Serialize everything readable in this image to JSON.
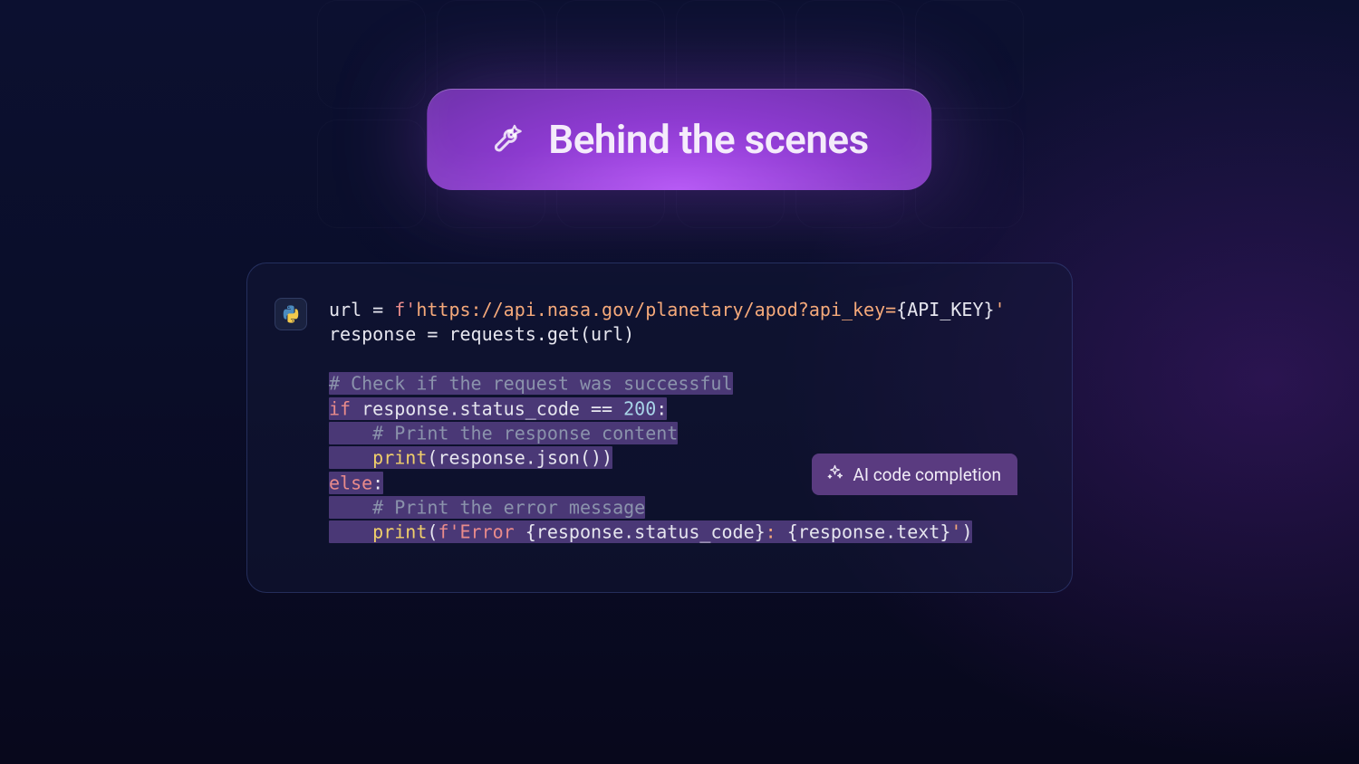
{
  "header": {
    "title": "Behind the scenes",
    "icon": "tools-icon"
  },
  "code_card": {
    "language": "python",
    "lines": {
      "l1": {
        "var": "url = ",
        "fprefix": "f'",
        "urlstr": "https://api.nasa.gov/planetary/apod?api_key=",
        "interp": "{API_KEY}",
        "endq": "'"
      },
      "l2": "response = requests.get(url)",
      "l4_comment": "# Check if the request was successful",
      "l5": {
        "kw": "if",
        "cond": " response.status_code == ",
        "num": "200",
        "colon": ":"
      },
      "l6_comment": "# Print the response content",
      "l7": {
        "indent": "    ",
        "fn": "print",
        "args": "(response.json())"
      },
      "l8": {
        "kw": "else",
        "colon": ":"
      },
      "l9_comment": "# Print the error message",
      "l10": {
        "indent": "    ",
        "fn": "print",
        "open": "(",
        "f1": "f'Error ",
        "i1": "{response.status_code}",
        "mid": ": ",
        "i2": "{response.text}",
        "endq": "'",
        "close": ")"
      }
    }
  },
  "ai_chip": {
    "label": "AI code completion"
  }
}
